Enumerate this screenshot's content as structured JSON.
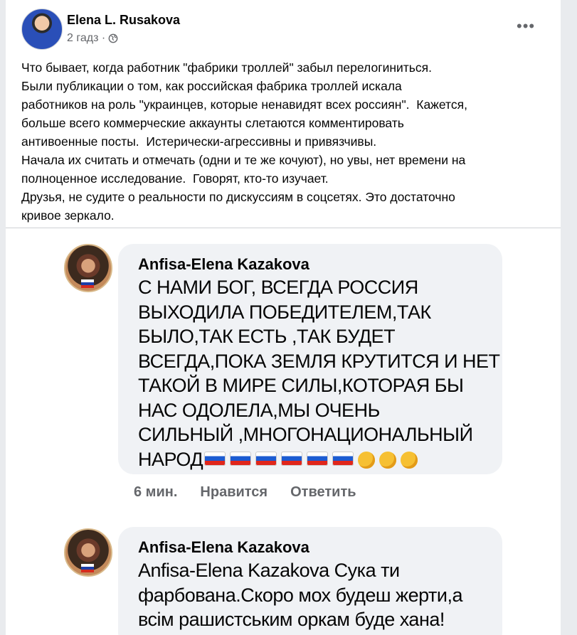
{
  "post": {
    "author": "Elena L. Rusakova",
    "time": "2 гадз ·",
    "more_label": "•••",
    "text": "Что бывает, когда работник \"фабрики троллей\" забыл перелогиниться.\nБыли публикации о том, как российская фабрика троллей искала\nработников на роль \"украинцев, которые ненавидят всех россиян\".  Кажется,\nбольше всего коммерческие аккаунты слетаются комментировать\nантивоенные посты.  Истерически-агрессивны и привязчивы.\nНачала их считать и отмечать (одни и те же кочуют), но увы, нет времени на\nполноценное исследование.  Говорят, кто-то изучает.\nДрузья, не судите о реальности по дискуссиям в соцсетях. Это достаточно\nкривое зеркало."
  },
  "comments": [
    {
      "author": "Anfisa-Elena Kazakova",
      "text": "С НАМИ БОГ, ВСЕГДА РОССИЯ\nВЫХОДИЛА ПОБЕДИТЕЛЕМ,ТАК\nБЫЛО,ТАК ЕСТЬ ,ТАК БУДЕТ\nВСЕГДА,ПОКА ЗЕМЛЯ КРУТИТСЯ И НЕТ\nТАКОЙ В МИРЕ СИЛЫ,КОТОРАЯ БЫ\nНАС ОДОЛЕЛА,МЫ ОЧЕНЬ\nСИЛЬНЫЙ ,МНОГОНАЦИОНАЛЬНЫЙ\nНАРОД",
      "time": "6 мин.",
      "like_label": "Нравится",
      "reply_label": "Ответить"
    },
    {
      "author": "Anfisa-Elena Kazakova",
      "text": "Anfisa-Elena Kazakova Сука ти\nфарбована.Скоро мох будеш жерти,а\nвсім рашистським оркам буде хана!"
    }
  ],
  "icons": {
    "globe": "globe-icon",
    "flag": "russia-flag-emoji",
    "fist": "fist-emoji"
  },
  "colors": {
    "text": "#050505",
    "secondary": "#65676b",
    "bubble": "#f0f2f5",
    "background": "#e9ebee"
  }
}
